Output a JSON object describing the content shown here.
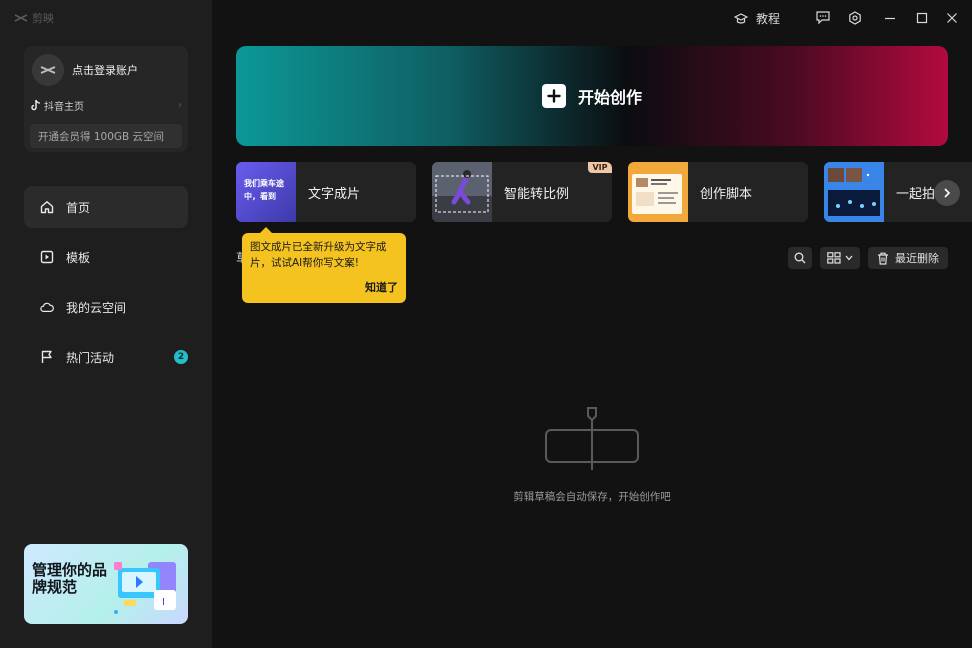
{
  "app": {
    "name": "剪映"
  },
  "titlebar": {
    "tutorial_label": "教程",
    "icons": [
      "tutorial-cap-icon",
      "feedback-icon",
      "settings-icon",
      "minimize-icon",
      "maximize-icon",
      "close-icon"
    ]
  },
  "account": {
    "login_label": "点击登录账户",
    "douyin_label": "抖音主页",
    "vip_label": "开通会员得 100GB 云空间"
  },
  "nav": {
    "items": [
      {
        "label": "首页",
        "icon": "home-icon",
        "active": true
      },
      {
        "label": "模板",
        "icon": "template-icon"
      },
      {
        "label": "我的云空间",
        "icon": "cloud-icon"
      },
      {
        "label": "热门活动",
        "icon": "flag-icon",
        "badge": "2"
      }
    ]
  },
  "promo": {
    "title": "管理你的品牌规范"
  },
  "hero": {
    "label": "开始创作"
  },
  "tools": [
    {
      "label": "文字成片",
      "thumb_text": "我们乘车途中，看到"
    },
    {
      "label": "智能转比例",
      "vip": "VIP"
    },
    {
      "label": "创作脚本"
    },
    {
      "label": "一起拍"
    }
  ],
  "tooltip": {
    "text": "图文成片已全新升级为文字成片，试试AI帮你写文案!",
    "button": "知道了"
  },
  "drafts": {
    "peek": "草"
  },
  "toolbar": {
    "recent_delete_label": "最近删除"
  },
  "empty": {
    "text": "剪辑草稿会自动保存，开始创作吧"
  },
  "colors": {
    "accent_teal": "#22bfc9",
    "tooltip_yellow": "#f4c31f",
    "hero_left": "#0c9897",
    "hero_right": "#b30a3e"
  }
}
